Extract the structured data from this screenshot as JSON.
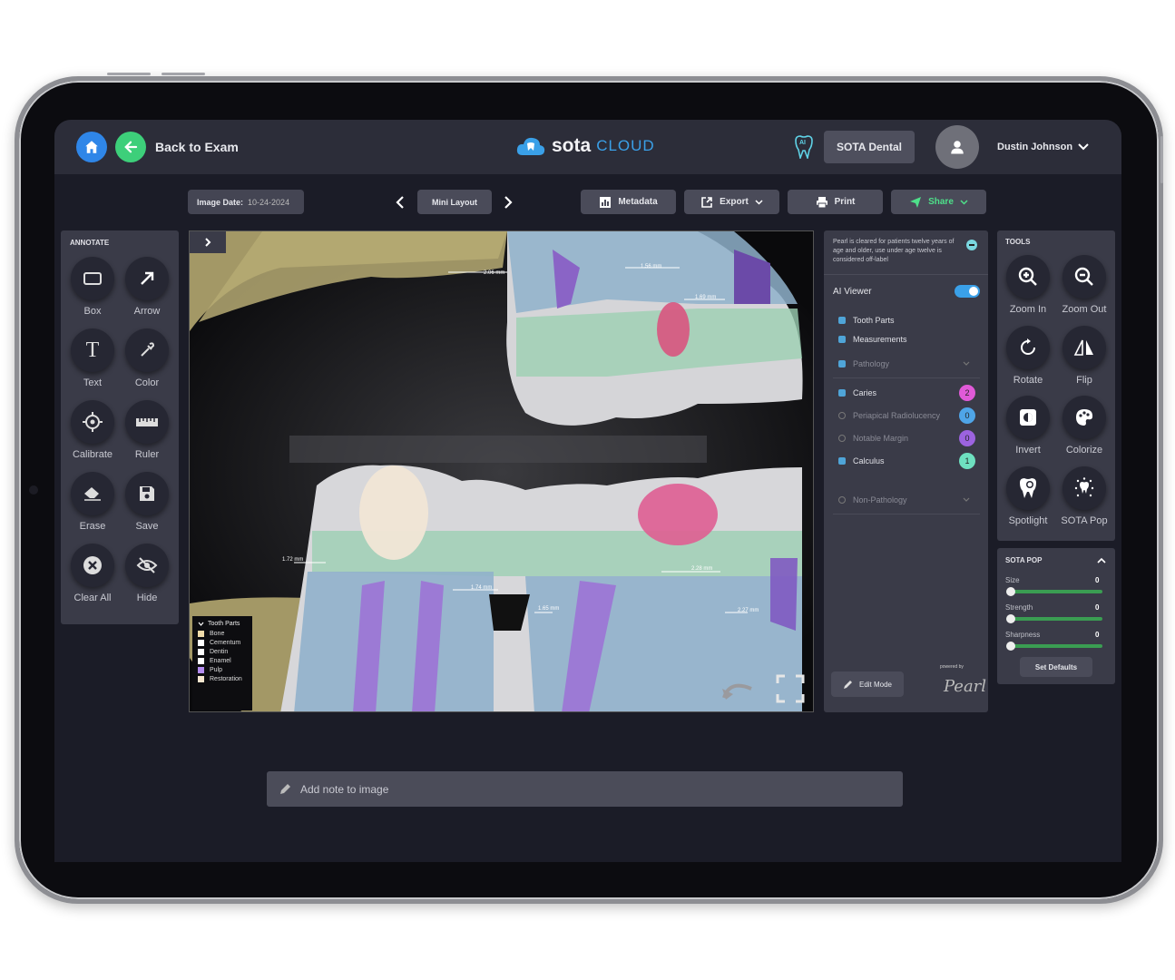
{
  "header": {
    "back_label": "Back to Exam",
    "logo_main": "sota",
    "logo_sub": "CLOUD",
    "practice": "SOTA Dental",
    "user": "Dustin Johnson",
    "ai_badge": "AI"
  },
  "toolbar": {
    "image_date_label": "Image Date:",
    "image_date": "10-24-2024",
    "layout": "Mini Layout",
    "metadata": "Metadata",
    "export": "Export",
    "print": "Print",
    "share": "Share"
  },
  "annotate": {
    "title": "ANNOTATE",
    "items": [
      "Box",
      "Arrow",
      "Text",
      "Color",
      "Calibrate",
      "Ruler",
      "Erase",
      "Save",
      "Clear All",
      "Hide"
    ]
  },
  "tools": {
    "title": "TOOLS",
    "items": [
      "Zoom In",
      "Zoom Out",
      "Rotate",
      "Flip",
      "Invert",
      "Colorize",
      "Spotlight",
      "SOTA Pop"
    ]
  },
  "sota_pop": {
    "title": "SOTA POP",
    "size_label": "Size",
    "size": "0",
    "strength_label": "Strength",
    "strength": "0",
    "sharpness_label": "Sharpness",
    "sharpness": "0",
    "defaults": "Set Defaults"
  },
  "ai_panel": {
    "notice": "Pearl is cleared for patients twelve years of age and older, use under age twelve is considered off-label",
    "viewer": "AI Viewer",
    "tooth_parts": "Tooth Parts",
    "measurements": "Measurements",
    "pathology": "Pathology",
    "caries": "Caries",
    "caries_count": "2",
    "periapical": "Periapical Radiolucency",
    "periapical_count": "0",
    "notable": "Notable Margin",
    "notable_count": "0",
    "calculus": "Calculus",
    "calculus_count": "1",
    "non_pathology": "Non-Pathology",
    "edit_mode": "Edit Mode",
    "powered_by": "powered by",
    "brand": "Pearl"
  },
  "xray": {
    "legend_title": "Tooth Parts",
    "legend": [
      "Bone",
      "Cementum",
      "Dentin",
      "Enamel",
      "Pulp",
      "Restoration"
    ],
    "legend_colors": [
      "#f0dcaa",
      "#ffffff",
      "#ffffff",
      "#ffffff",
      "#b48cf0",
      "#f5e6cf"
    ],
    "measures": [
      "2.06 mm",
      "1.56 mm",
      "1.69 mm",
      "1.72 mm",
      "1.74 mm",
      "1.65 mm",
      "2.28 mm",
      "2.27 mm"
    ]
  },
  "note_placeholder": "Add note to image"
}
